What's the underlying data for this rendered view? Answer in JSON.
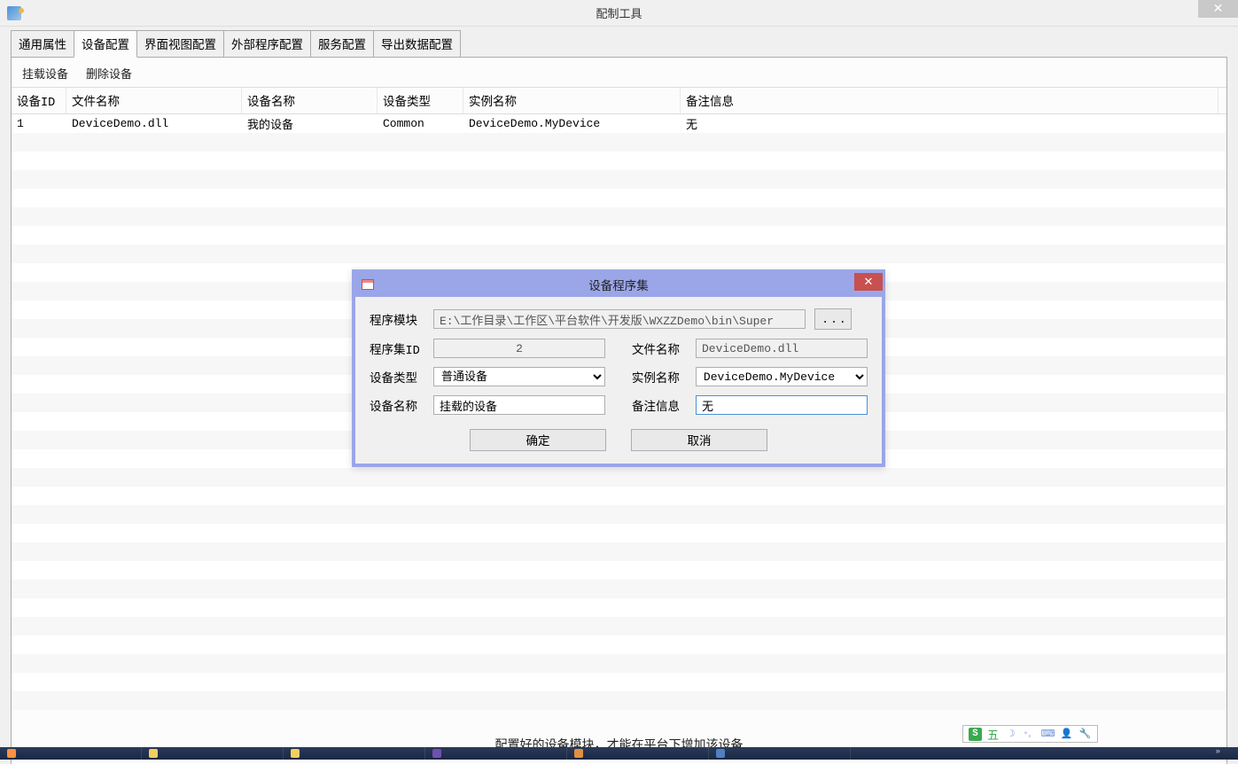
{
  "window": {
    "title": "配制工具",
    "close": "✕"
  },
  "tabs": [
    {
      "label": "通用属性"
    },
    {
      "label": "设备配置"
    },
    {
      "label": "界面视图配置"
    },
    {
      "label": "外部程序配置"
    },
    {
      "label": "服务配置"
    },
    {
      "label": "导出数据配置"
    }
  ],
  "toolbar": {
    "mount": "挂载设备",
    "delete": "删除设备"
  },
  "grid": {
    "headers": {
      "id": "设备ID",
      "file": "文件名称",
      "devname": "设备名称",
      "devtype": "设备类型",
      "instance": "实例名称",
      "remark": "备注信息"
    },
    "rows": [
      {
        "id": "1",
        "file": "DeviceDemo.dll",
        "devname": "我的设备",
        "devtype": "Common",
        "instance": "DeviceDemo.MyDevice",
        "remark": "无"
      }
    ]
  },
  "footer": "配置好的设备模块，才能在平台下增加该设备",
  "dialog": {
    "title": "设备程序集",
    "close": "✕",
    "labels": {
      "module": "程序模块",
      "asmId": "程序集ID",
      "file": "文件名称",
      "devtype": "设备类型",
      "instance": "实例名称",
      "devname": "设备名称",
      "remark": "备注信息"
    },
    "values": {
      "module": "E:\\工作目录\\工作区\\平台软件\\开发版\\WXZZDemo\\bin\\Super",
      "asmId": "2",
      "file": "DeviceDemo.dll",
      "devtype": "普通设备",
      "instance": "DeviceDemo.MyDevice",
      "devname": "挂载的设备",
      "remark": "无"
    },
    "browse": "...",
    "ok": "确定",
    "cancel": "取消"
  },
  "ime": {
    "logo": "S",
    "text": "五",
    "moon": "☽",
    "punct": "°，",
    "keyboard": "⌨",
    "user": "👤",
    "tool": "🔧"
  }
}
